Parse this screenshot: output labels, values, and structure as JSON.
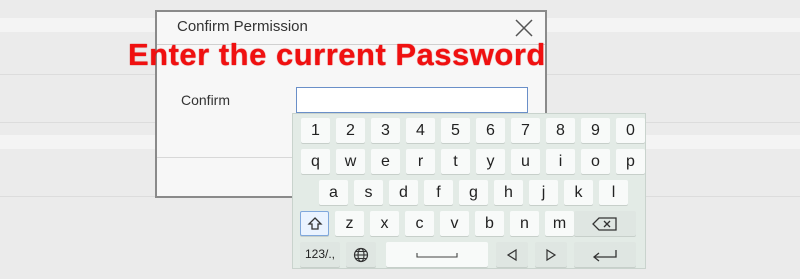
{
  "dialog": {
    "title": "Confirm Permission",
    "field_label": "Confirm",
    "field_value": "",
    "close_icon": "close-icon"
  },
  "overlay": {
    "caption": "Enter the current Password",
    "color": "#f01010"
  },
  "keyboard": {
    "row1": [
      "1",
      "2",
      "3",
      "4",
      "5",
      "6",
      "7",
      "8",
      "9",
      "0"
    ],
    "row2": [
      "q",
      "w",
      "e",
      "r",
      "t",
      "y",
      "u",
      "i",
      "o",
      "p"
    ],
    "row3": [
      "a",
      "s",
      "d",
      "f",
      "g",
      "h",
      "j",
      "k",
      "l"
    ],
    "row4": [
      "z",
      "x",
      "c",
      "v",
      "b",
      "n",
      "m"
    ],
    "mode_label": "123/.,",
    "icons": {
      "shift": "shift-icon",
      "backspace": "backspace-icon",
      "globe": "globe-icon",
      "space": "space-icon",
      "left": "arrow-left-icon",
      "right": "arrow-right-icon",
      "enter": "enter-icon"
    }
  }
}
